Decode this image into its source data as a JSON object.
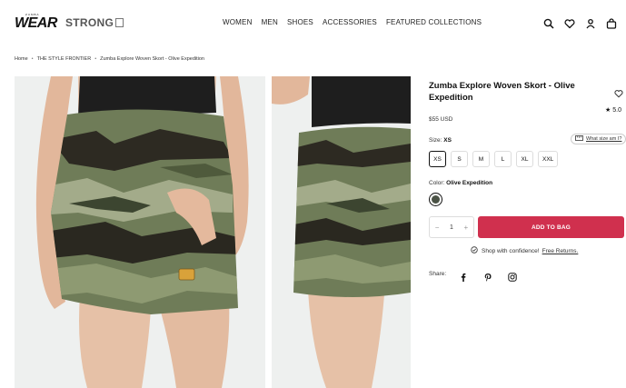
{
  "header": {
    "logo_small": "ZUMBA",
    "logo_main": "WEAR",
    "logo_secondary": "STRONG",
    "nav": [
      "WOMEN",
      "MEN",
      "SHOES",
      "ACCESSORIES",
      "FEATURED COLLECTIONS"
    ],
    "icons": [
      "search-icon",
      "heart-icon",
      "account-icon",
      "bag-icon"
    ]
  },
  "breadcrumb": [
    "Home",
    "THE STYLE FRONTIER",
    "Zumba Explore Woven Skort - Olive Expedition"
  ],
  "product": {
    "title": "Zumba Explore Woven Skort - Olive Expedition",
    "rating": "5.0",
    "price": "$55 USD",
    "size_label": "Size:",
    "size_selected": "XS",
    "size_guide": "What size am I?",
    "sizes": [
      "XS",
      "S",
      "M",
      "L",
      "XL",
      "XXL"
    ],
    "color_label": "Color:",
    "color_selected": "Olive Expedition",
    "swatch_color": "#4a5245",
    "quantity": "1",
    "qty_minus": "−",
    "qty_plus": "+",
    "add_to_bag": "ADD TO BAG",
    "confidence_text": "Shop with confidence!",
    "returns_link": "Free Returns.",
    "share_label": "Share:"
  },
  "colors": {
    "accent": "#d0304e",
    "text": "#1a1a1a"
  }
}
